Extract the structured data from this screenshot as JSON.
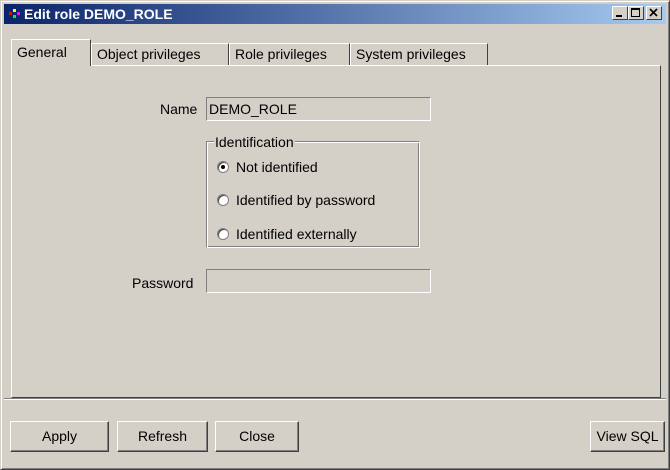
{
  "window": {
    "title": "Edit role DEMO_ROLE",
    "controls": [
      "minimize-icon",
      "maximize-icon",
      "close-icon"
    ]
  },
  "tabs": [
    {
      "label": "General",
      "active": true
    },
    {
      "label": "Object privileges",
      "active": false
    },
    {
      "label": "Role privileges",
      "active": false
    },
    {
      "label": "System privileges",
      "active": false
    }
  ],
  "general": {
    "name_label": "Name",
    "name_value": "DEMO_ROLE",
    "identification": {
      "legend": "Identification",
      "options": [
        {
          "label": "Not identified",
          "selected": true
        },
        {
          "label": "Identified by password",
          "selected": false
        },
        {
          "label": "Identified externally",
          "selected": false
        }
      ]
    },
    "password_label": "Password",
    "password_value": ""
  },
  "buttons": {
    "apply": "Apply",
    "refresh": "Refresh",
    "close": "Close",
    "view_sql": "View SQL"
  },
  "colors": {
    "face": "#d4d0c8",
    "title_start": "#0a246a",
    "title_end": "#a6caf0"
  }
}
